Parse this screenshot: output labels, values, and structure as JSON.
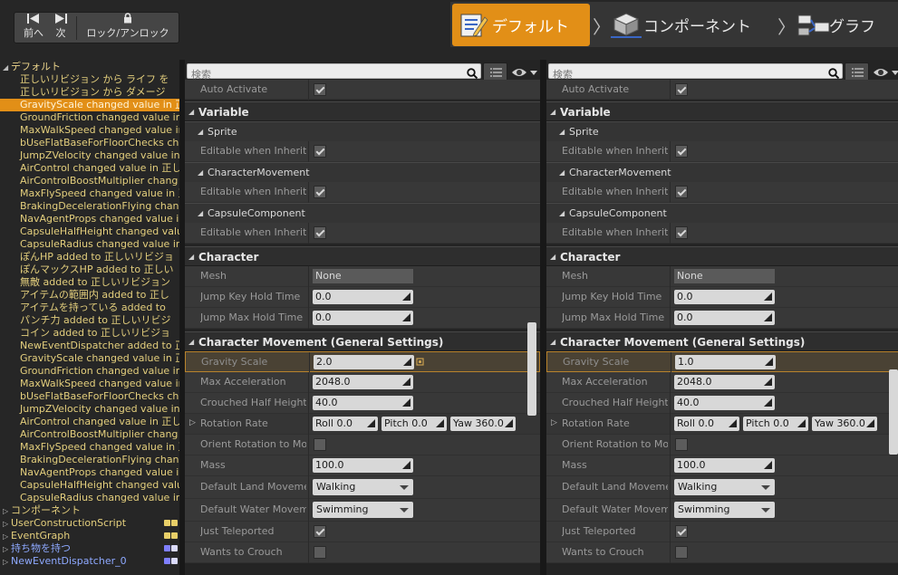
{
  "toolbar": {
    "back_label": "前へ",
    "forward_label": "次",
    "lock_label": "ロック/アンロック"
  },
  "modes": [
    {
      "label": "デフォルト",
      "icon": "default-mode-icon",
      "active": true
    },
    {
      "label": "コンポーネント",
      "icon": "component-mode-icon",
      "active": false
    },
    {
      "label": "グラフ",
      "icon": "graph-mode-icon",
      "active": false
    }
  ],
  "colors": {
    "accent": "#e28f17",
    "tree_text": "#e4cf7d",
    "tree_blue": "#8ea9ff"
  },
  "tree": {
    "root": "デフォルト",
    "items": [
      "正しいリビジョン から ライフ を",
      "正しいリビジョン から ダメージ",
      "GravityScale changed value in 正",
      "GroundFriction changed value in",
      "MaxWalkSpeed changed value in",
      "bUseFlatBaseForFloorChecks ch",
      "JumpZVelocity changed value in",
      "AirControl changed value in 正し",
      "AirControlBoostMultiplier chang",
      "MaxFlySpeed changed value in 正",
      "BrakingDecelerationFlying chang",
      "NavAgentProps changed value i",
      "CapsuleHalfHeight changed valu",
      "CapsuleRadius changed value in",
      "ぽんHP added to 正しいリビジョ",
      "ぽんマックスHP added to 正しい",
      "無敵 added to 正しいリビジョン",
      "アイテムの範囲内 added to 正し",
      "アイテムを持っている added to",
      "パンチ力 added to 正しいリビジ",
      "コイン added to 正しいリビジョ",
      "NewEventDispatcher added to 正",
      "GravityScale changed value in 正",
      "GroundFriction changed value in",
      "MaxWalkSpeed changed value in",
      "bUseFlatBaseForFloorChecks ch",
      "JumpZVelocity changed value in",
      "AirControl changed value in 正し",
      "AirControlBoostMultiplier chang",
      "MaxFlySpeed changed value in 正",
      "BrakingDecelerationFlying chang",
      "NavAgentProps changed value i",
      "CapsuleHalfHeight changed valu",
      "CapsuleRadius changed value in"
    ],
    "categories": [
      {
        "label": "コンポーネント",
        "blue": false,
        "badges": []
      },
      {
        "label": "UserConstructionScript",
        "blue": false,
        "badges": [
          "#e8cf68",
          "#e8cf68"
        ]
      },
      {
        "label": "EventGraph",
        "blue": false,
        "badges": [
          "#e8cf68",
          "#e8cf68"
        ]
      },
      {
        "label": "持ち物を持つ",
        "blue": true,
        "badges": [
          "#7f7fff",
          "#dcdcff"
        ]
      },
      {
        "label": "NewEventDispatcher_0",
        "blue": true,
        "badges": [
          "#7f7fff",
          "#dcdcff"
        ]
      }
    ]
  },
  "search_placeholder": "検索",
  "details": {
    "auto_activate": "Auto Activate",
    "variable": "Variable",
    "sprite": "Sprite",
    "character_movement_sub": "CharacterMovement",
    "capsule_component": "CapsuleComponent",
    "editable": "Editable when Inherit",
    "character": "Character",
    "mesh": "Mesh",
    "mesh_value": "None",
    "jump_key_hold_time": "Jump Key Hold Time",
    "jump_key_value": "0.0",
    "jump_max_hold_time": "Jump Max Hold Time",
    "jump_max_value": "0.0",
    "cm_general": "Character Movement (General Settings)",
    "gravity_scale": "Gravity Scale",
    "max_acceleration": "Max Acceleration",
    "max_acceleration_value": "2048.0",
    "crouched_half_height": "Crouched Half Height",
    "crouched_value": "40.0",
    "rotation_rate": "Rotation Rate",
    "roll": "Roll  0.0",
    "pitch": "Pitch  0.0",
    "yaw": "Yaw  360.0",
    "orient_rotation": "Orient Rotation to Mov",
    "mass": "Mass",
    "mass_value": "100.0",
    "default_land": "Default Land Movemer",
    "walking": "Walking",
    "default_water": "Default Water Moveme",
    "swimming": "Swimming",
    "just_teleported": "Just Teleported",
    "wants_to_crouch": "Wants to Crouch"
  },
  "left_panel": {
    "gravity_value": "2.0"
  },
  "right_panel": {
    "gravity_value": "1.0"
  }
}
